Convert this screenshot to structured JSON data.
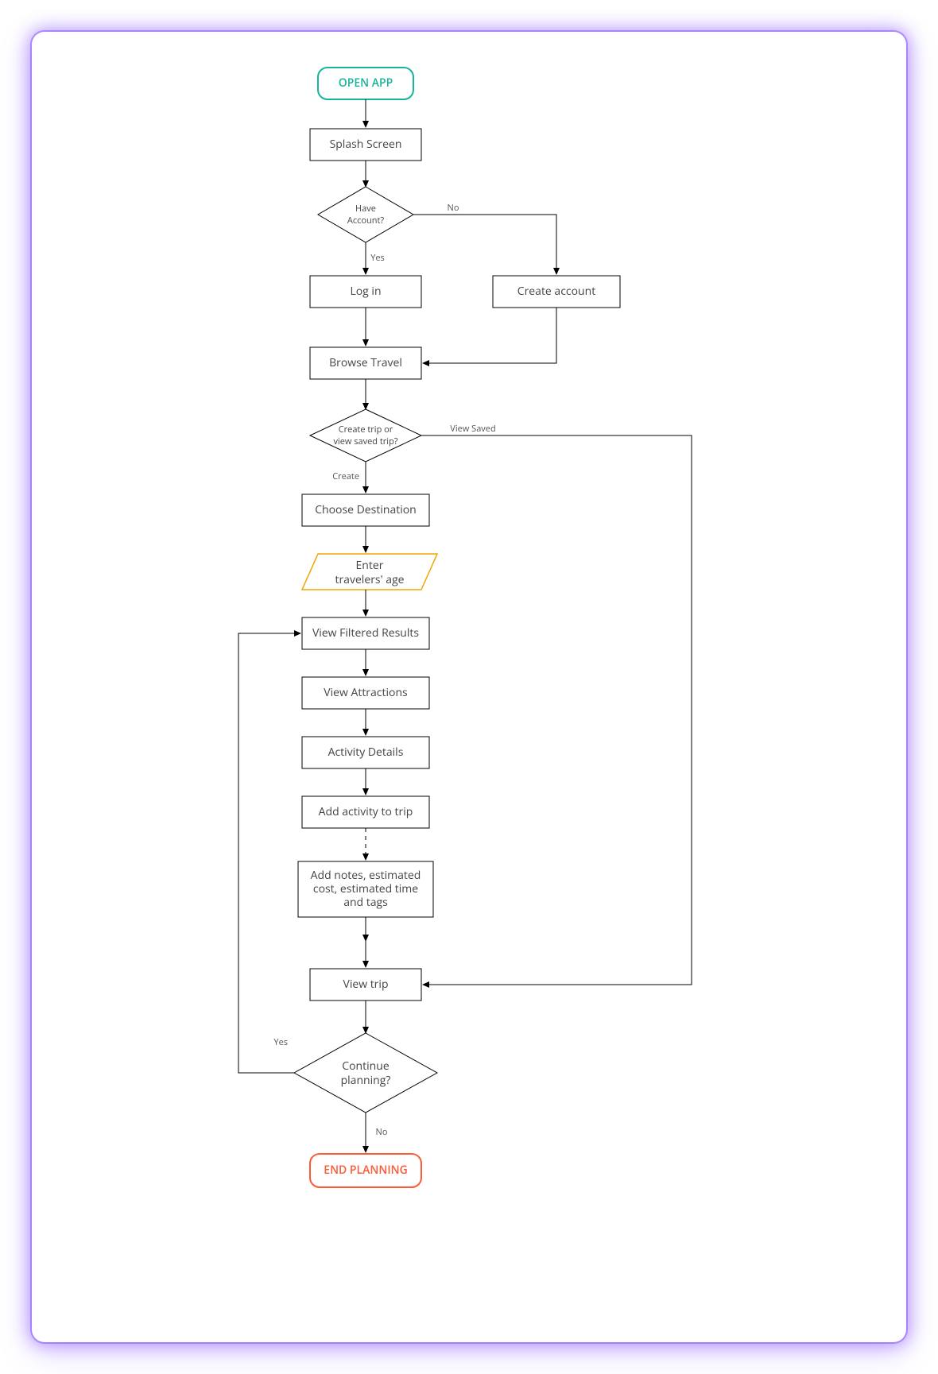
{
  "nodes": {
    "open_app": "OPEN APP",
    "splash": "Splash Screen",
    "have_account_1": "Have",
    "have_account_2": "Account?",
    "log_in": "Log in",
    "create_account": "Create account",
    "browse_travel": "Browse Travel",
    "create_or_view_1": "Create trip or",
    "create_or_view_2": "view saved trip?",
    "choose_destination": "Choose Destination",
    "enter_age_1": "Enter",
    "enter_age_2": "travelers' age",
    "view_filtered": "View Filtered Results",
    "view_attractions": "View Attractions",
    "activity_details": "Activity Details",
    "add_activity": "Add activity to trip",
    "add_notes_1": "Add notes, estimated",
    "add_notes_2": "cost, estimated time",
    "add_notes_3": "and tags",
    "view_trip": "View trip",
    "continue_1": "Continue",
    "continue_2": "planning?",
    "end_planning": "END PLANNING"
  },
  "edges": {
    "no": "No",
    "yes": "Yes",
    "view_saved": "View Saved",
    "create": "Create"
  }
}
